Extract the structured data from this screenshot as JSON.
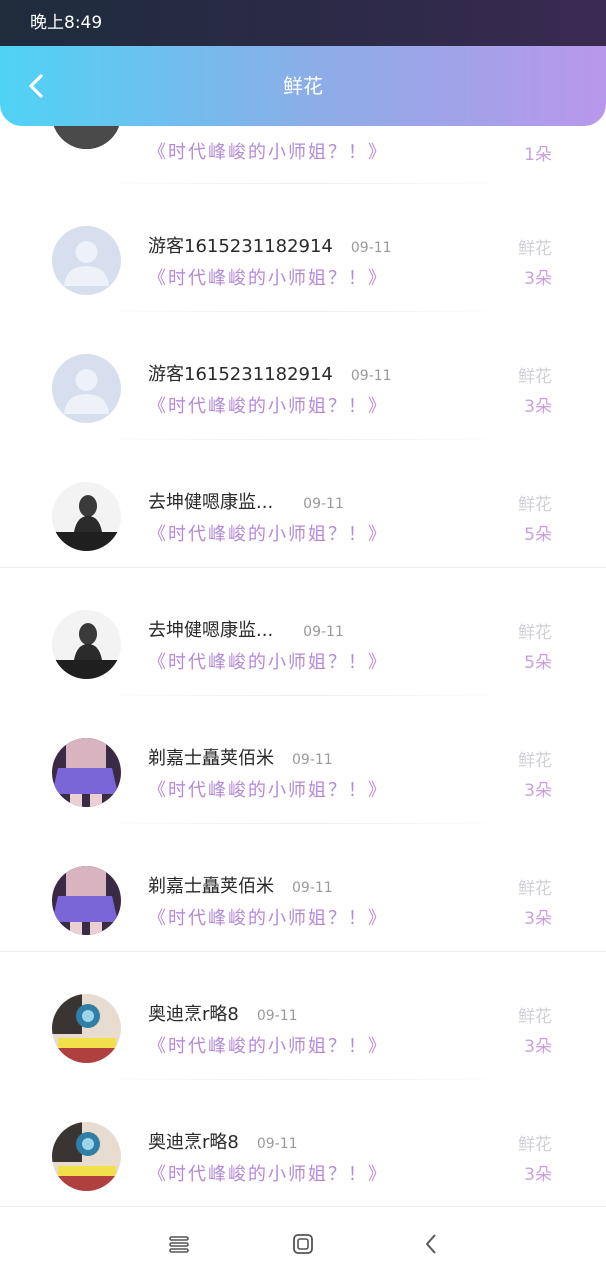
{
  "status": {
    "time": "晚上8:49"
  },
  "header": {
    "title": "鲜花",
    "back_icon": "chevron-left-icon"
  },
  "colors": {
    "accent_start": "#4fd3f6",
    "accent_end": "#b997ea",
    "message": "#b58ad8"
  },
  "rows": [
    {
      "name": "",
      "date": "",
      "message": "《时代峰峻的小师姐？！》",
      "gift": "",
      "count": "1朵",
      "avatar": "dark-photo"
    },
    {
      "name": "游客1615231182914",
      "date": "09-11",
      "message": "《时代峰峻的小师姐？！》",
      "gift": "鲜花",
      "count": "3朵",
      "avatar": "default-user"
    },
    {
      "name": "游客1615231182914",
      "date": "09-11",
      "message": "《时代峰峻的小师姐？！》",
      "gift": "鲜花",
      "count": "3朵",
      "avatar": "default-user"
    },
    {
      "name": "去坤健嗯康监...",
      "date": "09-11",
      "message": "《时代峰峻的小师姐？！》",
      "gift": "鲜花",
      "count": "5朵",
      "avatar": "bw-girl"
    },
    {
      "name": "去坤健嗯康监...",
      "date": "09-11",
      "message": "《时代峰峻的小师姐？！》",
      "gift": "鲜花",
      "count": "5朵",
      "avatar": "bw-girl"
    },
    {
      "name": "剃嘉士矗荚佰米",
      "date": "09-11",
      "message": "《时代峰峻的小师姐？！》",
      "gift": "鲜花",
      "count": "3朵",
      "avatar": "purple-skirt"
    },
    {
      "name": "剃嘉士矗荚佰米",
      "date": "09-11",
      "message": "《时代峰峻的小师姐？！》",
      "gift": "鲜花",
      "count": "3朵",
      "avatar": "purple-skirt"
    },
    {
      "name": "奥迪烹r略8",
      "date": "09-11",
      "message": "《时代峰峻的小师姐？！》",
      "gift": "鲜花",
      "count": "3朵",
      "avatar": "spiral-photo"
    },
    {
      "name": "奥迪烹r略8",
      "date": "09-11",
      "message": "《时代峰峻的小师姐？！》",
      "gift": "鲜花",
      "count": "3朵",
      "avatar": "spiral-photo"
    }
  ],
  "navbar": {
    "menu_icon": "menu-icon",
    "home_icon": "home-square-icon",
    "back_icon": "back-chevron-icon"
  }
}
